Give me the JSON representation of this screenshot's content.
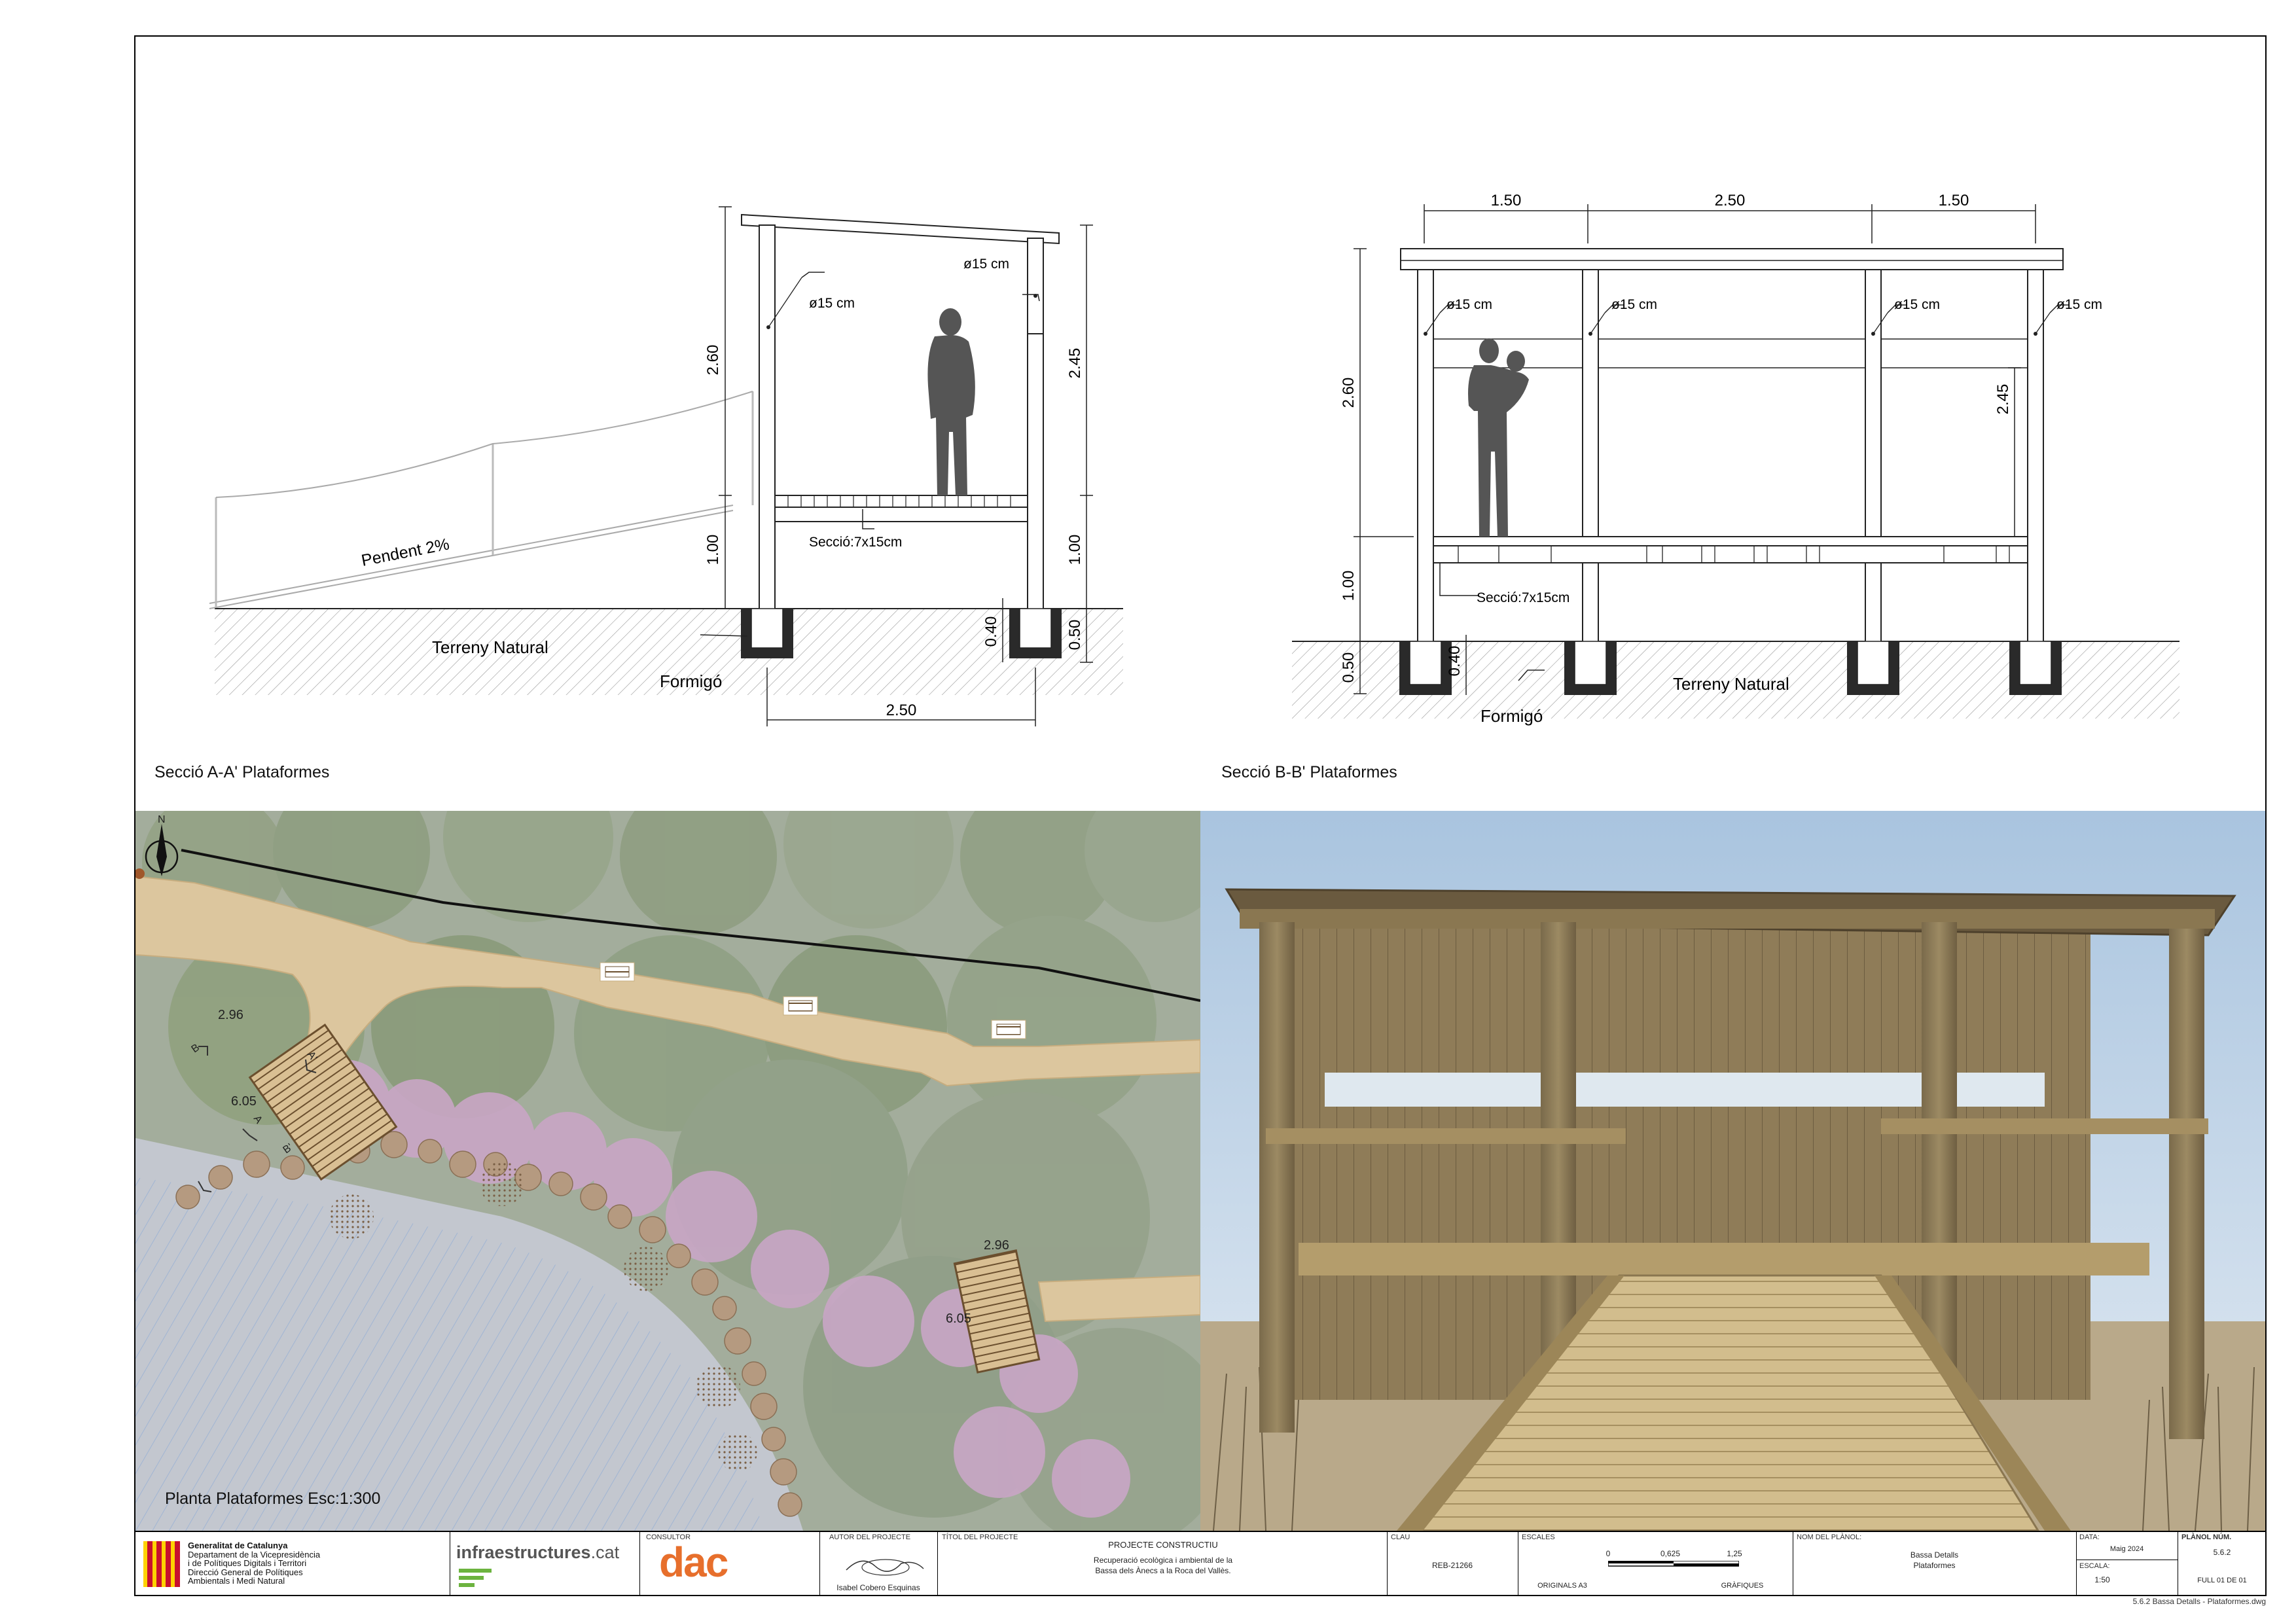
{
  "section_aa": {
    "caption": "Secció A-A' Plataformes",
    "dim_height_total": "2.60",
    "dim_height_roof": "2.45",
    "dim_deck_left": "1.00",
    "dim_deck_right": "1.00",
    "dim_footing_a": "0.40",
    "dim_footing_b": "0.50",
    "dim_width": "2.50",
    "post_left": "ø15 cm",
    "post_right": "ø15 cm",
    "beam": "Secció:7x15cm",
    "slope": "Pendent 2%",
    "ground": "Terreny Natural",
    "concrete": "Formigó"
  },
  "section_bb": {
    "caption": "Secció B-B' Plataformes",
    "dim_top": [
      "1.50",
      "2.50",
      "1.50"
    ],
    "dim_height_total": "2.60",
    "dim_height_roof": "2.45",
    "dim_deck": "1.00",
    "dim_footing_a": "0.50",
    "dim_footing_b": "0.40",
    "posts": [
      "ø15 cm",
      "ø15 cm",
      "ø15 cm",
      "ø15 cm"
    ],
    "beam": "Secció:7x15cm",
    "ground": "Terreny Natural",
    "concrete": "Formigó"
  },
  "plan": {
    "caption": "Planta Plataformes Esc:1:300",
    "north": "N",
    "p1_w": "2.96",
    "p1_l": "6.05",
    "p2_w": "2.96",
    "p2_l": "6.05",
    "mark_a": "A",
    "mark_a2": "A'",
    "mark_b": "B",
    "mark_b2": "B'"
  },
  "title_block": {
    "org_lines": [
      "Generalitat de Catalunya",
      "Departament de la Vicepresidència",
      "i de Polítiques Digitals i Territori",
      "Direcció General de Polítiques",
      "Ambientals i Medi Natural"
    ],
    "infra_logo": "infraestructures",
    "infra_tld": ".cat",
    "consultor_label": "CONSULTOR",
    "dac_logo": "dac",
    "autor_label": "AUTOR DEL PROJECTE",
    "autor_name": "Isabel Cobero Esquinas",
    "titol_label": "TÍTOL DEL PROJECTE",
    "project_type": "PROJECTE CONSTRUCTIU",
    "project_title_1": "Recuperació ecològica i ambiental de la",
    "project_title_2": "Bassa dels Ànecs a la Roca del Vallès.",
    "clau_label": "CLAU",
    "clau": "REB-21266",
    "escales_label": "ESCALES",
    "scale_0": "0",
    "scale_1": "0,625",
    "scale_2": "1,25",
    "originals": "ORIGINALS A3",
    "grafiques": "GRÀFIQUES",
    "nom_label": "NOM DEL PLÀNOL:",
    "nom_1": "Bassa Detalls",
    "nom_2": "Plataformes",
    "data_label": "DATA:",
    "data": "Maig 2024",
    "escala_label": "ESCALA:",
    "escala": "1:50",
    "planol_label": "PLÀNOL NÚM.",
    "planol": "5.6.2",
    "full": "FULL 01 DE 01",
    "filename": "5.6.2 Bassa Detalls - Plataformes.dwg"
  }
}
